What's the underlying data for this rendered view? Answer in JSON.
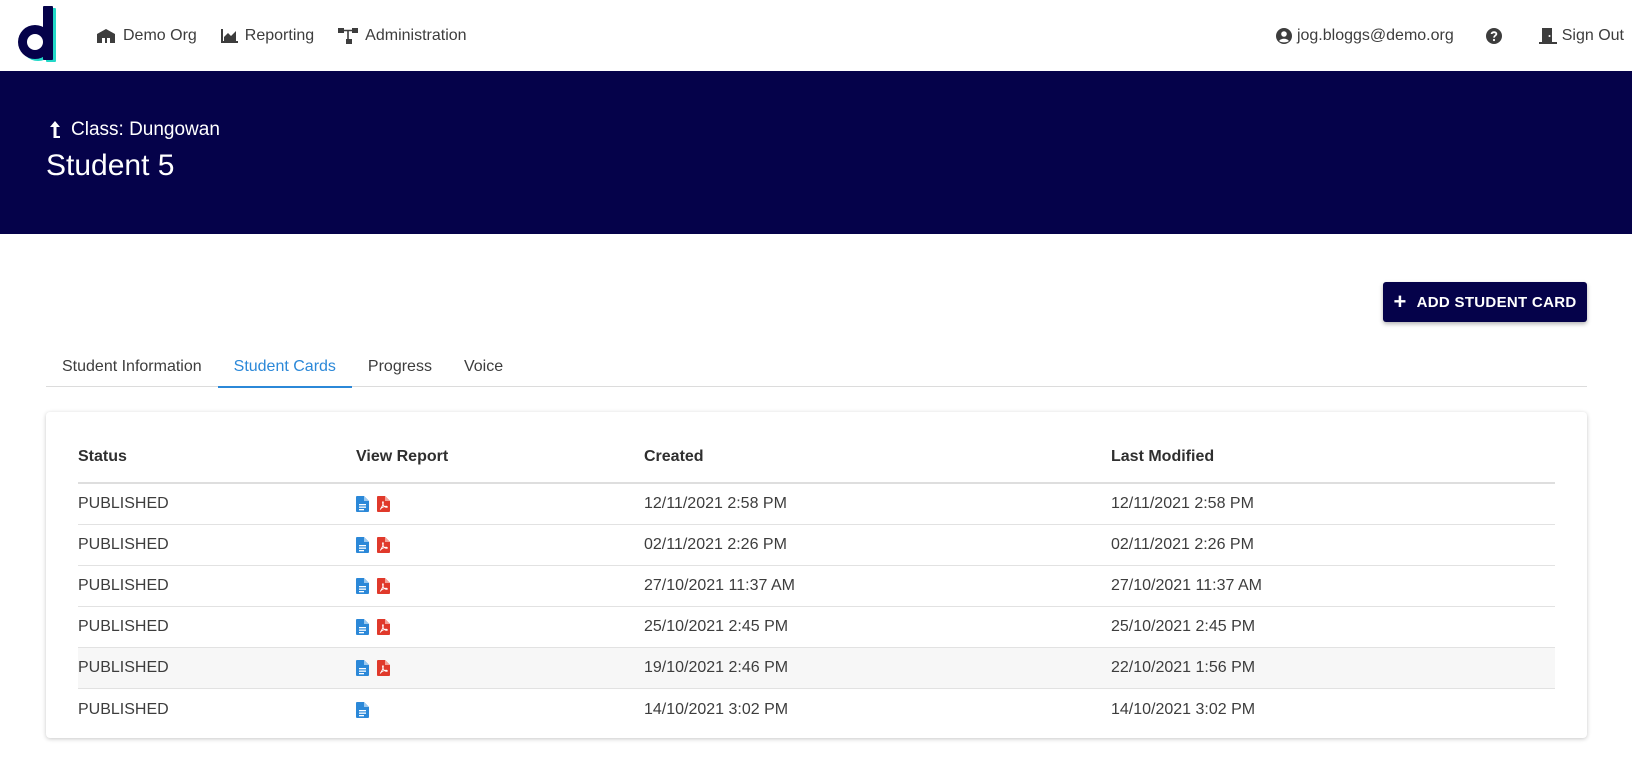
{
  "nav": {
    "org": "Demo Org",
    "reporting": "Reporting",
    "administration": "Administration",
    "user": "jog.bloggs@demo.org",
    "sign_out": "Sign Out"
  },
  "banner": {
    "breadcrumb": "Class: Dungowan",
    "title": "Student 5"
  },
  "actions": {
    "add_label": "ADD STUDENT CARD"
  },
  "tabs": [
    {
      "label": "Student Information",
      "active": false
    },
    {
      "label": "Student Cards",
      "active": true
    },
    {
      "label": "Progress",
      "active": false
    },
    {
      "label": "Voice",
      "active": false
    }
  ],
  "table": {
    "headers": [
      "Status",
      "View Report",
      "Created",
      "Last Modified"
    ],
    "rows": [
      {
        "status": "PUBLISHED",
        "doc": true,
        "pdf": true,
        "created": "12/11/2021 2:58 PM",
        "modified": "12/11/2021 2:58 PM"
      },
      {
        "status": "PUBLISHED",
        "doc": true,
        "pdf": true,
        "created": "02/11/2021 2:26 PM",
        "modified": "02/11/2021 2:26 PM"
      },
      {
        "status": "PUBLISHED",
        "doc": true,
        "pdf": true,
        "created": "27/10/2021 11:37 AM",
        "modified": "27/10/2021 11:37 AM"
      },
      {
        "status": "PUBLISHED",
        "doc": true,
        "pdf": true,
        "created": "25/10/2021 2:45 PM",
        "modified": "25/10/2021 2:45 PM"
      },
      {
        "status": "PUBLISHED",
        "doc": true,
        "pdf": true,
        "created": "19/10/2021 2:46 PM",
        "modified": "22/10/2021 1:56 PM"
      },
      {
        "status": "PUBLISHED",
        "doc": true,
        "pdf": false,
        "created": "14/10/2021 3:02 PM",
        "modified": "14/10/2021 3:02 PM"
      }
    ]
  },
  "colors": {
    "brand_navy": "#05024a",
    "accent_teal": "#23d8c8",
    "tab_active": "#2b88d8",
    "doc_icon": "#2b88d8",
    "pdf_icon": "#e0392b"
  }
}
